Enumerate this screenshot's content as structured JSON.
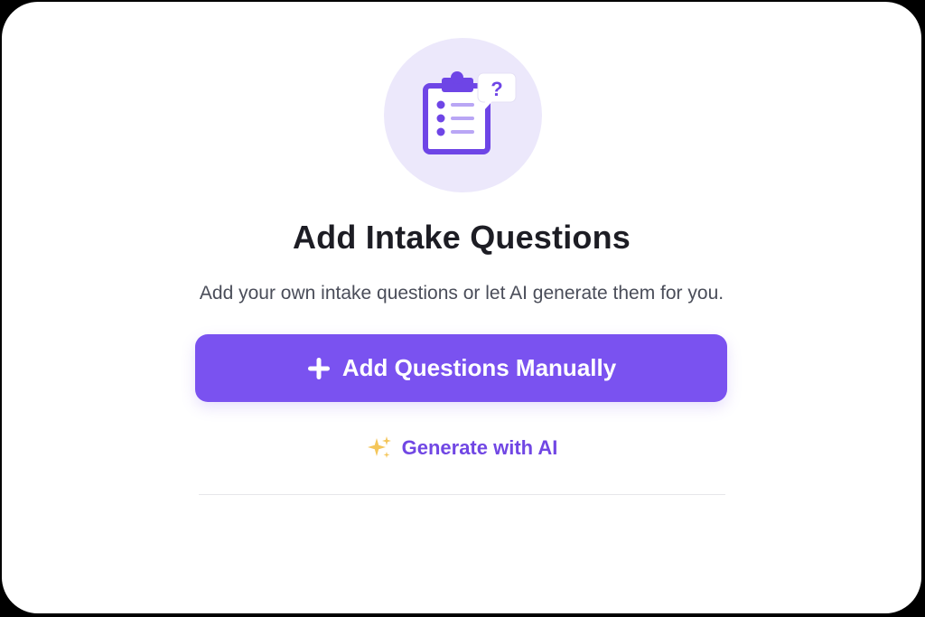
{
  "header": {
    "icon": "clipboard-question-icon",
    "title": "Add Intake Questions",
    "subtitle": "Add your own intake questions or let AI generate them for you.",
    "badge_glyph": "?"
  },
  "actions": {
    "primary": {
      "icon": "plus-icon",
      "label": "Add Questions Manually"
    },
    "secondary": {
      "icon": "sparkle-icon",
      "label": "Generate with AI"
    }
  },
  "colors": {
    "accent": "#7a52f0",
    "accent_light": "#ece8fb",
    "link": "#7147e4",
    "sparkle": "#f4c65a"
  }
}
